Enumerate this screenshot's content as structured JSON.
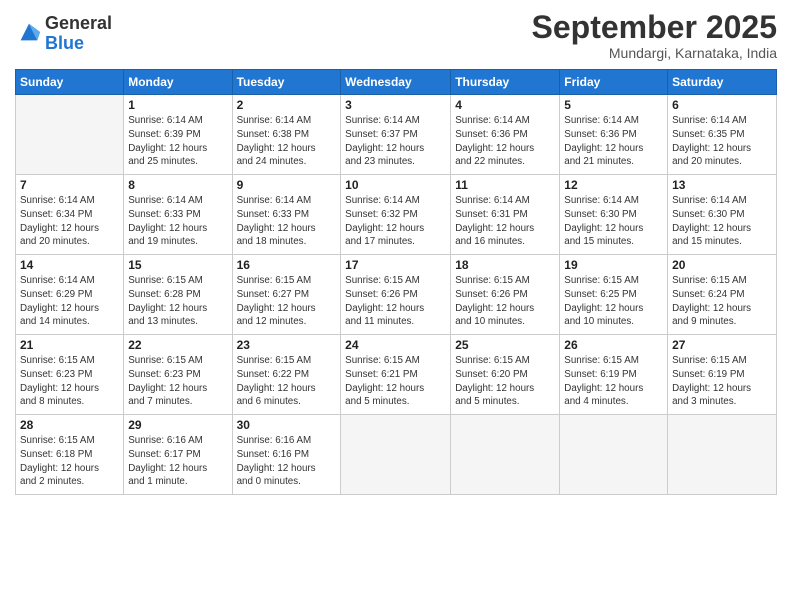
{
  "logo": {
    "general": "General",
    "blue": "Blue"
  },
  "title": "September 2025",
  "location": "Mundargi, Karnataka, India",
  "days_header": [
    "Sunday",
    "Monday",
    "Tuesday",
    "Wednesday",
    "Thursday",
    "Friday",
    "Saturday"
  ],
  "weeks": [
    [
      {
        "num": "",
        "info": ""
      },
      {
        "num": "1",
        "info": "Sunrise: 6:14 AM\nSunset: 6:39 PM\nDaylight: 12 hours\nand 25 minutes."
      },
      {
        "num": "2",
        "info": "Sunrise: 6:14 AM\nSunset: 6:38 PM\nDaylight: 12 hours\nand 24 minutes."
      },
      {
        "num": "3",
        "info": "Sunrise: 6:14 AM\nSunset: 6:37 PM\nDaylight: 12 hours\nand 23 minutes."
      },
      {
        "num": "4",
        "info": "Sunrise: 6:14 AM\nSunset: 6:36 PM\nDaylight: 12 hours\nand 22 minutes."
      },
      {
        "num": "5",
        "info": "Sunrise: 6:14 AM\nSunset: 6:36 PM\nDaylight: 12 hours\nand 21 minutes."
      },
      {
        "num": "6",
        "info": "Sunrise: 6:14 AM\nSunset: 6:35 PM\nDaylight: 12 hours\nand 20 minutes."
      }
    ],
    [
      {
        "num": "7",
        "info": "Sunrise: 6:14 AM\nSunset: 6:34 PM\nDaylight: 12 hours\nand 20 minutes."
      },
      {
        "num": "8",
        "info": "Sunrise: 6:14 AM\nSunset: 6:33 PM\nDaylight: 12 hours\nand 19 minutes."
      },
      {
        "num": "9",
        "info": "Sunrise: 6:14 AM\nSunset: 6:33 PM\nDaylight: 12 hours\nand 18 minutes."
      },
      {
        "num": "10",
        "info": "Sunrise: 6:14 AM\nSunset: 6:32 PM\nDaylight: 12 hours\nand 17 minutes."
      },
      {
        "num": "11",
        "info": "Sunrise: 6:14 AM\nSunset: 6:31 PM\nDaylight: 12 hours\nand 16 minutes."
      },
      {
        "num": "12",
        "info": "Sunrise: 6:14 AM\nSunset: 6:30 PM\nDaylight: 12 hours\nand 15 minutes."
      },
      {
        "num": "13",
        "info": "Sunrise: 6:14 AM\nSunset: 6:30 PM\nDaylight: 12 hours\nand 15 minutes."
      }
    ],
    [
      {
        "num": "14",
        "info": "Sunrise: 6:14 AM\nSunset: 6:29 PM\nDaylight: 12 hours\nand 14 minutes."
      },
      {
        "num": "15",
        "info": "Sunrise: 6:15 AM\nSunset: 6:28 PM\nDaylight: 12 hours\nand 13 minutes."
      },
      {
        "num": "16",
        "info": "Sunrise: 6:15 AM\nSunset: 6:27 PM\nDaylight: 12 hours\nand 12 minutes."
      },
      {
        "num": "17",
        "info": "Sunrise: 6:15 AM\nSunset: 6:26 PM\nDaylight: 12 hours\nand 11 minutes."
      },
      {
        "num": "18",
        "info": "Sunrise: 6:15 AM\nSunset: 6:26 PM\nDaylight: 12 hours\nand 10 minutes."
      },
      {
        "num": "19",
        "info": "Sunrise: 6:15 AM\nSunset: 6:25 PM\nDaylight: 12 hours\nand 10 minutes."
      },
      {
        "num": "20",
        "info": "Sunrise: 6:15 AM\nSunset: 6:24 PM\nDaylight: 12 hours\nand 9 minutes."
      }
    ],
    [
      {
        "num": "21",
        "info": "Sunrise: 6:15 AM\nSunset: 6:23 PM\nDaylight: 12 hours\nand 8 minutes."
      },
      {
        "num": "22",
        "info": "Sunrise: 6:15 AM\nSunset: 6:23 PM\nDaylight: 12 hours\nand 7 minutes."
      },
      {
        "num": "23",
        "info": "Sunrise: 6:15 AM\nSunset: 6:22 PM\nDaylight: 12 hours\nand 6 minutes."
      },
      {
        "num": "24",
        "info": "Sunrise: 6:15 AM\nSunset: 6:21 PM\nDaylight: 12 hours\nand 5 minutes."
      },
      {
        "num": "25",
        "info": "Sunrise: 6:15 AM\nSunset: 6:20 PM\nDaylight: 12 hours\nand 5 minutes."
      },
      {
        "num": "26",
        "info": "Sunrise: 6:15 AM\nSunset: 6:19 PM\nDaylight: 12 hours\nand 4 minutes."
      },
      {
        "num": "27",
        "info": "Sunrise: 6:15 AM\nSunset: 6:19 PM\nDaylight: 12 hours\nand 3 minutes."
      }
    ],
    [
      {
        "num": "28",
        "info": "Sunrise: 6:15 AM\nSunset: 6:18 PM\nDaylight: 12 hours\nand 2 minutes."
      },
      {
        "num": "29",
        "info": "Sunrise: 6:16 AM\nSunset: 6:17 PM\nDaylight: 12 hours\nand 1 minute."
      },
      {
        "num": "30",
        "info": "Sunrise: 6:16 AM\nSunset: 6:16 PM\nDaylight: 12 hours\nand 0 minutes."
      },
      {
        "num": "",
        "info": ""
      },
      {
        "num": "",
        "info": ""
      },
      {
        "num": "",
        "info": ""
      },
      {
        "num": "",
        "info": ""
      }
    ]
  ]
}
